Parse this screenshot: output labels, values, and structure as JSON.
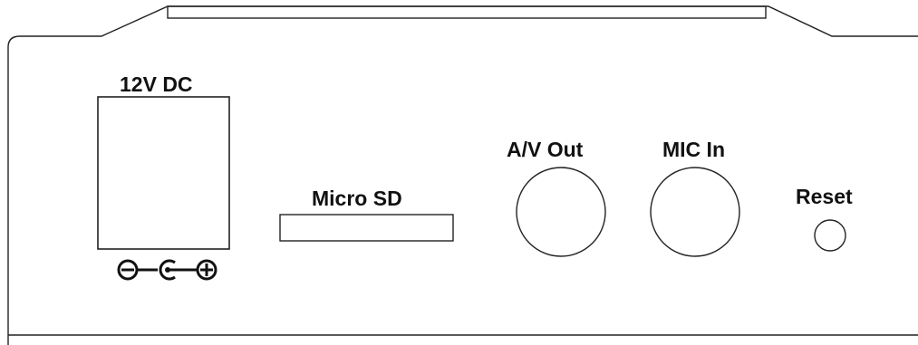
{
  "device_panel": {
    "labels": {
      "power": "12V DC",
      "sd_card": "Micro SD",
      "av_out": "A/V Out",
      "mic_in": "MIC In",
      "reset": "Reset"
    },
    "polarity_symbols": [
      "negative-symbol",
      "barrel-center-symbol",
      "positive-symbol"
    ]
  }
}
